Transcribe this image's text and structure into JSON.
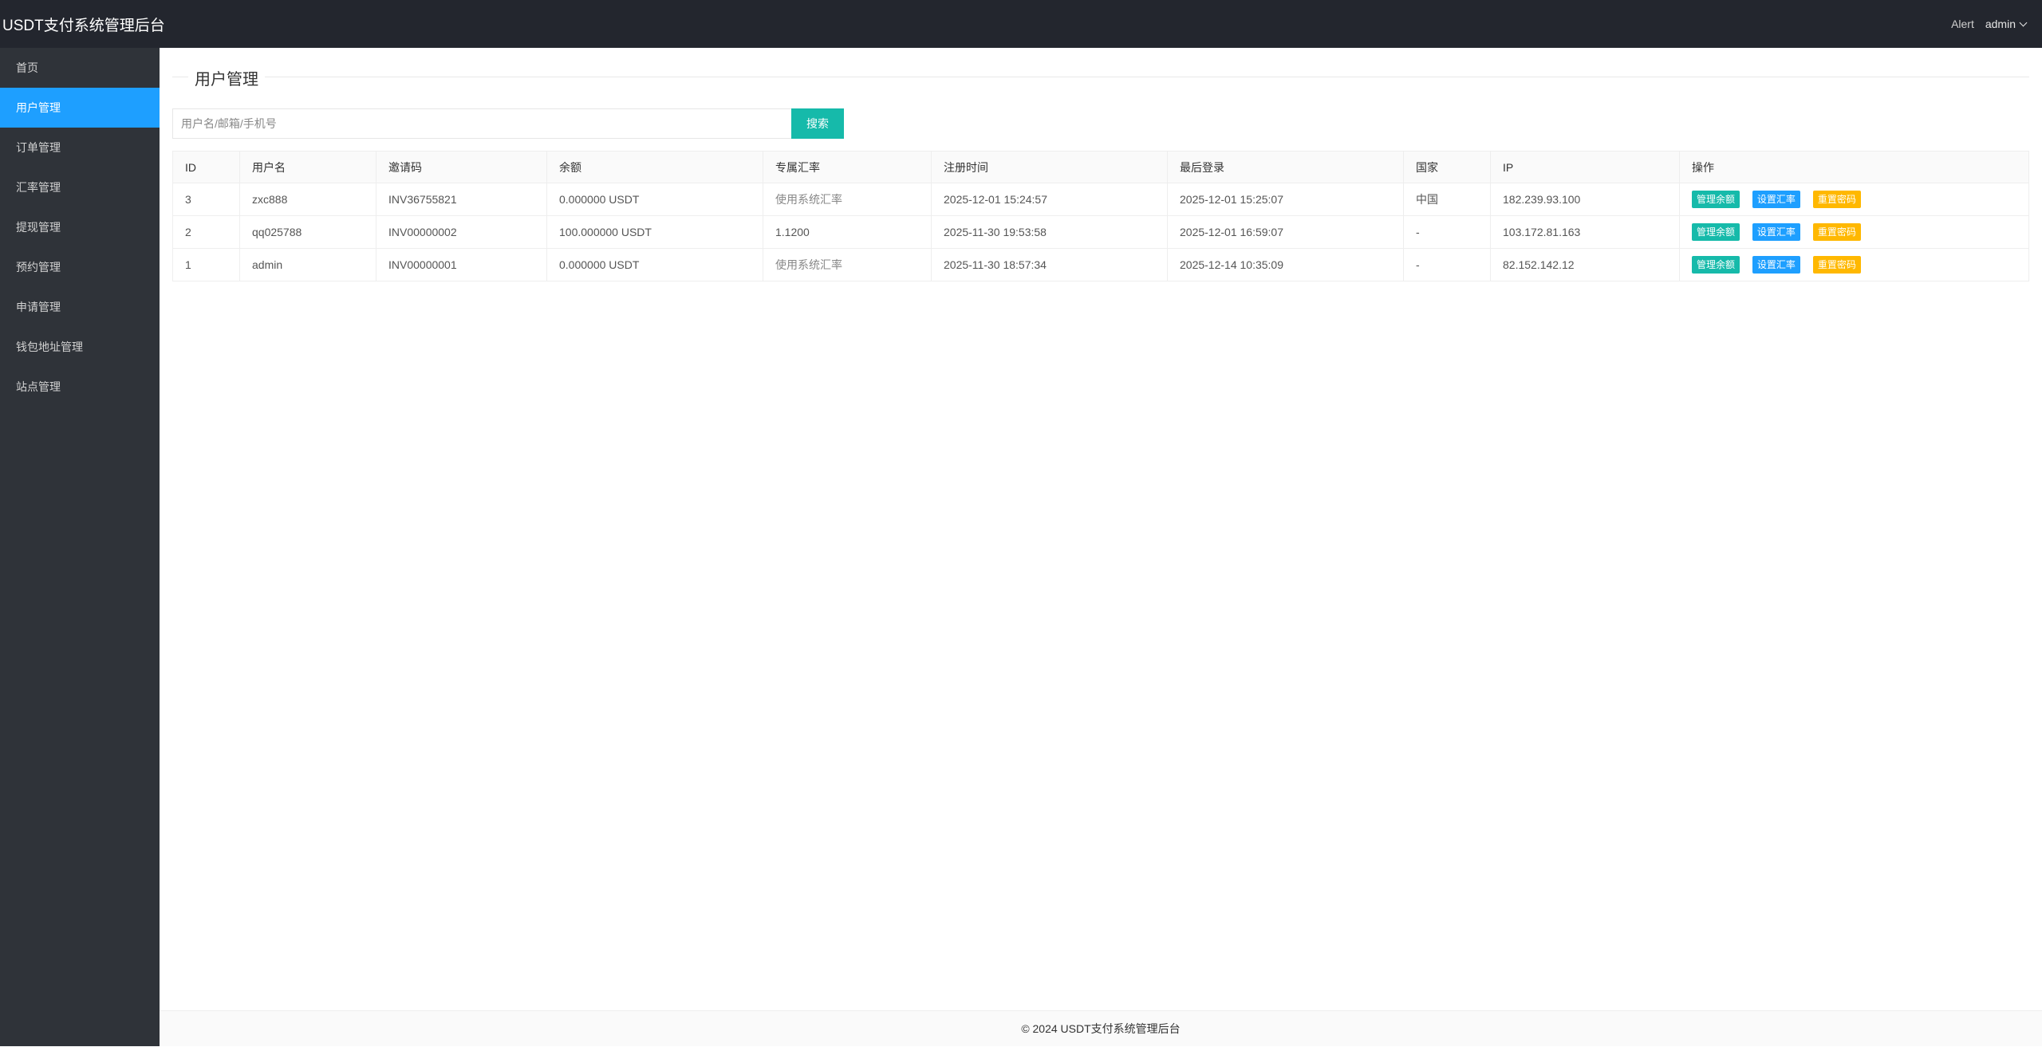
{
  "header": {
    "title": "USDT支付系统管理后台",
    "alert_text": "Alert",
    "username": "admin"
  },
  "sidebar": {
    "items": [
      {
        "label": "首页"
      },
      {
        "label": "用户管理",
        "active": true
      },
      {
        "label": "订单管理"
      },
      {
        "label": "汇率管理"
      },
      {
        "label": "提现管理"
      },
      {
        "label": "预约管理"
      },
      {
        "label": "申请管理"
      },
      {
        "label": "钱包地址管理"
      },
      {
        "label": "站点管理"
      }
    ]
  },
  "main": {
    "section_title": "用户管理",
    "search": {
      "placeholder": "用户名/邮箱/手机号",
      "value": "",
      "button_label": "搜索"
    },
    "table": {
      "columns": [
        "ID",
        "用户名",
        "邀请码",
        "余额",
        "专属汇率",
        "注册时间",
        "最后登录",
        "国家",
        "IP",
        "操作"
      ],
      "rows": [
        {
          "id": "3",
          "username": "zxc888",
          "invite": "INV36755821",
          "balance": "0.000000 USDT",
          "rate": "使用系统汇率",
          "registered": "2025-12-01 15:24:57",
          "last_login": "2025-12-01 15:25:07",
          "country": "中国",
          "ip": "182.239.93.100"
        },
        {
          "id": "2",
          "username": "qq025788",
          "invite": "INV00000002",
          "balance": "100.000000 USDT",
          "rate": "1.1200",
          "registered": "2025-11-30 19:53:58",
          "last_login": "2025-12-01 16:59:07",
          "country": "-",
          "ip": "103.172.81.163"
        },
        {
          "id": "1",
          "username": "admin",
          "invite": "INV00000001",
          "balance": "0.000000 USDT",
          "rate": "使用系统汇率",
          "registered": "2025-11-30 18:57:34",
          "last_login": "2025-12-14 10:35:09",
          "country": "-",
          "ip": "82.152.142.12"
        }
      ],
      "actions": {
        "manage_balance": "管理余额",
        "set_rate": "设置汇率",
        "reset_password": "重置密码"
      }
    }
  },
  "footer": {
    "text": "© 2024 USDT支付系统管理后台"
  },
  "colors": {
    "header_bg": "#23262e",
    "sidebar_bg": "#2f3339",
    "active_nav": "#1e9fff",
    "search_button": "#16baaa",
    "action_green": "#16baaa",
    "action_blue": "#1e9fff",
    "action_orange": "#ffb800"
  }
}
